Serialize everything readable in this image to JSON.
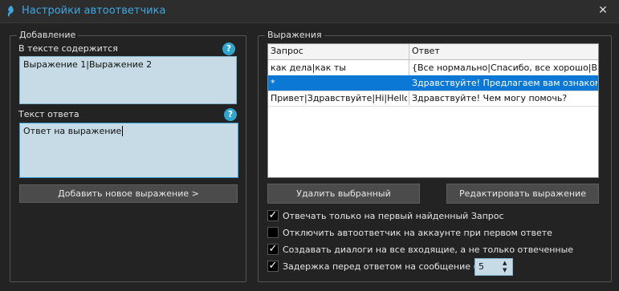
{
  "window": {
    "title": "Настройки автоответчика",
    "close_glyph": "✕"
  },
  "add_group": {
    "title": "Добавление",
    "contains_label": "В тексте содержится",
    "contains_value": "Выражение 1|Выражение 2",
    "reply_label": "Текст ответа",
    "reply_value": "Ответ на выражение",
    "help_glyph": "?",
    "add_button": "Добавить новое выражение >"
  },
  "expr_group": {
    "title": "Выражения",
    "columns": [
      "Запрос",
      "Ответ"
    ],
    "rows": [
      {
        "query": "как дела|как ты",
        "answer": "{Все нормально|Спасибо, все хорошо|Все ок}",
        "selected": false
      },
      {
        "query": "*",
        "answer": "Здравствуйте! Предлагаем вам ознакомиться",
        "selected": true
      },
      {
        "query": "Привет|Здравствуйте|Hi|Hello",
        "answer": "Здравствуйте! Чем могу помочь?",
        "selected": false
      }
    ],
    "delete_button": "Удалить выбранный",
    "edit_button": "Редактировать выражение"
  },
  "options": [
    {
      "label": "Отвечать только на первый найденный Запрос",
      "checked": true
    },
    {
      "label": "Отключить автоответчик на аккаунте при первом ответе",
      "checked": false
    },
    {
      "label": "Создавать диалоги на все входящие, а не только отвеченные",
      "checked": true
    },
    {
      "label": "Задержка перед ответом на сообщение (сек)",
      "checked": true
    }
  ],
  "delay": {
    "value": "5"
  },
  "colors": {
    "accent": "#3fa7e0",
    "selection": "#0a78d4",
    "field_bg": "#c6dbe6"
  }
}
